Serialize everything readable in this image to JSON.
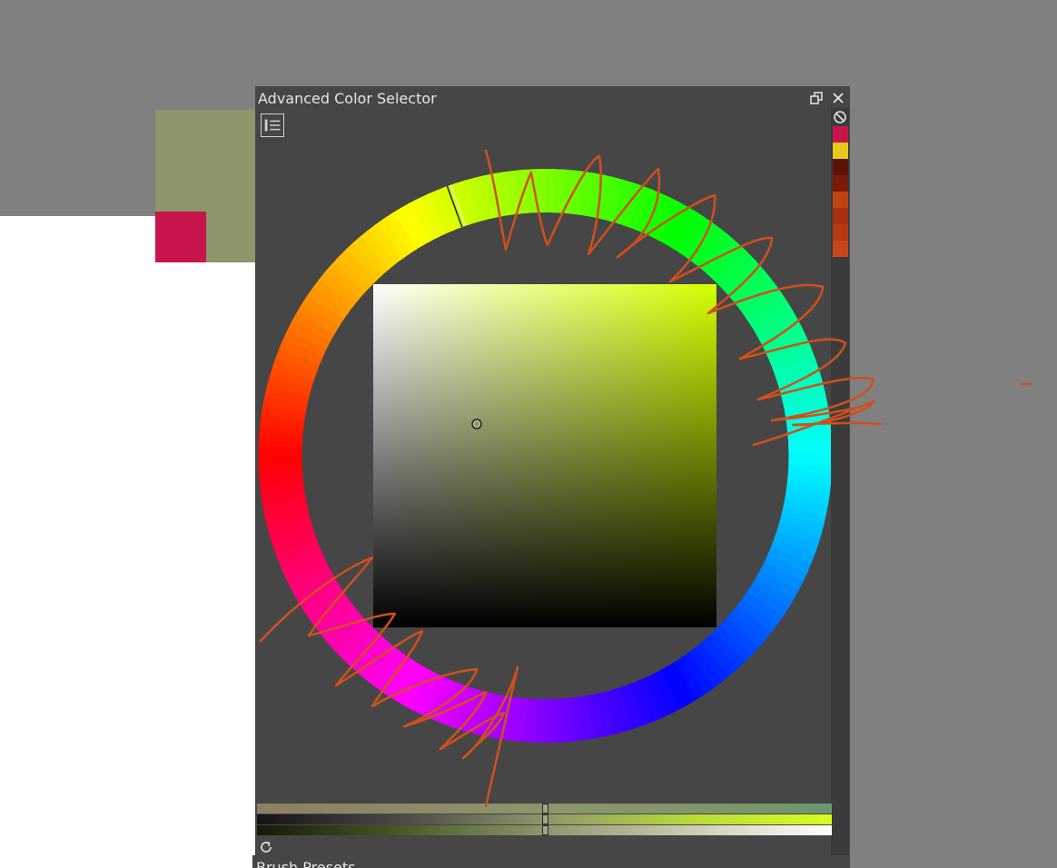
{
  "canvas": {
    "foreground_color": "#8c966a",
    "background_color": "#c8164c"
  },
  "docker": {
    "title": "Advanced Color Selector",
    "icons": {
      "float": "float-docker-icon",
      "close": "close-icon",
      "settings": "settings-list-icon",
      "no_color": "no-color-icon",
      "refresh": "refresh-icon"
    },
    "selected_hue_deg": 70,
    "selected_color": "#8c966a",
    "color_history": [
      "#c8164c",
      "#e8c81a",
      "#5a1206",
      "#7a1a08",
      "#c0420e",
      "#a83010",
      "#b83a10",
      "#c8461a"
    ],
    "sliders": [
      {
        "name": "hue",
        "handle_fraction": 0.5
      },
      {
        "name": "value",
        "handle_fraction": 0.5
      },
      {
        "name": "saturation",
        "handle_fraction": 0.5
      }
    ]
  },
  "next_docker": {
    "title": "Brush Presets"
  },
  "stroke_color": "#d0501c"
}
